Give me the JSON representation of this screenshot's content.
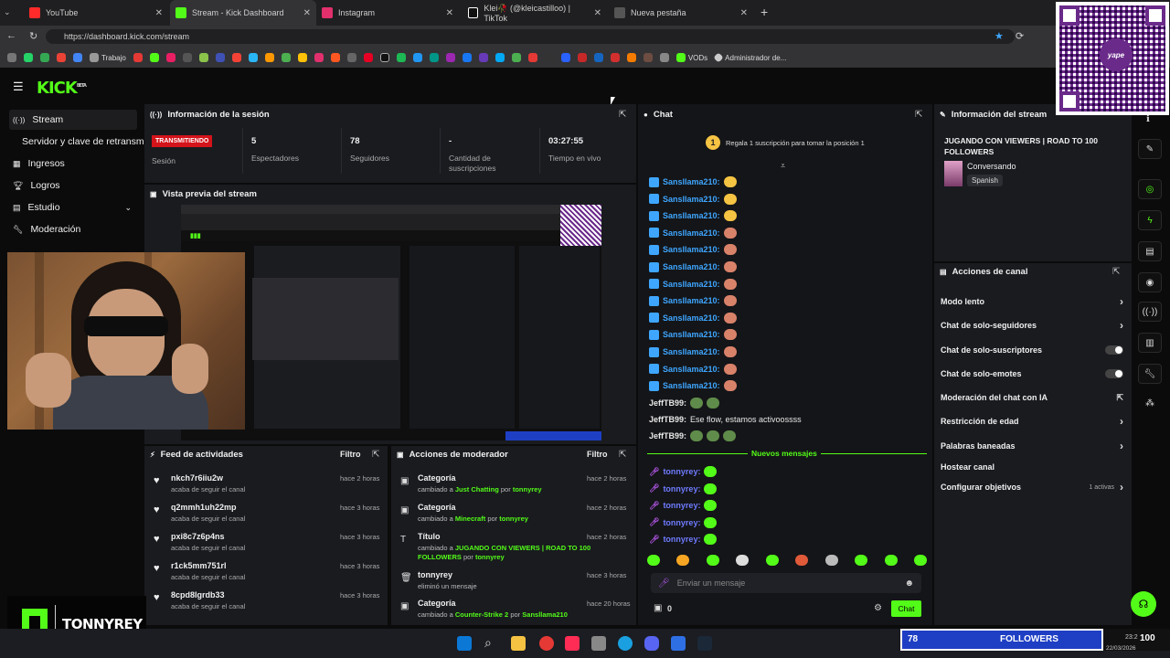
{
  "browser": {
    "tabs": [
      {
        "label": "YouTube",
        "color": "#ff2b2b"
      },
      {
        "label": "Stream - Kick Dashboard",
        "color": "#53fc18"
      },
      {
        "label": "Instagram",
        "color": "#e1306c"
      },
      {
        "label": "Klei🥀 (@kleicastilloo) | TikTok",
        "color": "#ffffff"
      },
      {
        "label": "Nueva pestaña",
        "color": "#cccccc"
      }
    ],
    "new_tab": "+",
    "url": "https://dashboard.kick.com/stream",
    "bookmarks": {
      "trabajo": "Trabajo",
      "vods": "VODs",
      "admin": "Administrador de..."
    }
  },
  "app": {
    "logo": "KICK",
    "logo_sup": "BETA"
  },
  "sidebar": {
    "items": [
      {
        "label": "Stream",
        "icon": "signal-icon"
      },
      {
        "label": "Servidor y clave de retransmisión",
        "icon": ""
      },
      {
        "label": "Ingresos",
        "icon": "grid-icon"
      },
      {
        "label": "Logros",
        "icon": "trophy-icon"
      },
      {
        "label": "Estudio",
        "icon": "book-icon"
      },
      {
        "label": "Moderación",
        "icon": "wrench-icon"
      }
    ]
  },
  "session": {
    "title": "Información de la sesión",
    "badge": "TRANSMITIENDO",
    "badge_label": "Sesión",
    "stats": [
      {
        "value": "5",
        "label": "Espectadores"
      },
      {
        "value": "78",
        "label": "Seguidores"
      },
      {
        "value": "-",
        "label": "Cantidad de suscripciones"
      },
      {
        "value": "03:27:55",
        "label": "Tiempo en vivo"
      }
    ]
  },
  "preview": {
    "title": "Vista previa del stream"
  },
  "feed": {
    "title": "Feed de actividades",
    "filter": "Filtro",
    "rows": [
      {
        "name": "nkch7r6iiu2w",
        "sub": "acaba de seguir el canal",
        "time": "hace 2 horas"
      },
      {
        "name": "q2mmh1uh22mp",
        "sub": "acaba de seguir el canal",
        "time": "hace 3 horas"
      },
      {
        "name": "pxi8c7z6p4ns",
        "sub": "acaba de seguir el canal",
        "time": "hace 3 horas"
      },
      {
        "name": "r1ck5mm751rl",
        "sub": "acaba de seguir el canal",
        "time": "hace 3 horas"
      },
      {
        "name": "8cpd8lgrdb33",
        "sub": "acaba de seguir el canal",
        "time": "hace 3 horas"
      }
    ]
  },
  "modactions": {
    "title": "Acciones de moderador",
    "filter": "Filtro",
    "rows": [
      {
        "title": "Categoría",
        "pre": "cambiado a",
        "value": "Just Chatting",
        "by": "por",
        "user": "tonnyrey",
        "time": "hace 2 horas"
      },
      {
        "title": "Categoría",
        "pre": "cambiado a",
        "value": "Minecraft",
        "by": "por",
        "user": "tonnyrey",
        "time": "hace 2 horas"
      },
      {
        "title": "Título",
        "pre": "cambiado a",
        "value": "JUGANDO CON VIEWERS | ROAD TO 100 FOLLOWERS",
        "by": "por",
        "user": "tonnyrey",
        "time": "hace 2 horas"
      },
      {
        "title": "tonnyrey",
        "pre": "eliminó un mensaje",
        "value": "",
        "by": "",
        "user": "",
        "time": "hace 3 horas"
      },
      {
        "title": "Categoría",
        "pre": "cambiado a",
        "value": "Counter-Strike 2",
        "by": "por",
        "user": "Sansllama210",
        "time": "hace 20 horas"
      }
    ]
  },
  "chat": {
    "title": "Chat",
    "gift_rank": "1",
    "gift_text": "Regala 1 suscripción para tomar la posición 1",
    "spam_user": "Sansllama210:",
    "jeff_user": "JeffTB99:",
    "jeff_msg": "Ese flow, estamos activoossss",
    "new_messages": "Nuevos mensajes",
    "tonny_user": "tonnyrey:",
    "input_placeholder": "Enviar un mensaje",
    "points": "0",
    "send": "Chat"
  },
  "streaminfo": {
    "title": "Información del stream",
    "stream_title": "JUGANDO CON VIEWERS | ROAD TO 100 FOLLOWERS",
    "category": "Conversando",
    "language": "Spanish"
  },
  "channel": {
    "title": "Acciones de canal",
    "rows": [
      {
        "label": "Modo lento",
        "kind": "chev"
      },
      {
        "label": "Chat de solo-seguidores",
        "kind": "chev"
      },
      {
        "label": "Chat de solo-suscriptores",
        "kind": "toggle"
      },
      {
        "label": "Chat de solo-emotes",
        "kind": "toggle"
      },
      {
        "label": "Moderación del chat con IA",
        "kind": "ext"
      },
      {
        "label": "Restricción de edad",
        "kind": "chev"
      },
      {
        "label": "Palabras baneadas",
        "kind": "chev"
      },
      {
        "label": "Hostear canal",
        "kind": "none"
      },
      {
        "label": "Configurar objetivos",
        "kind": "chev"
      }
    ],
    "goals_active": "1 activas"
  },
  "overlay": {
    "streamer_name": "TONNYREY",
    "followers_count": "78",
    "followers_label": "FOLLOWERS",
    "goal": "100",
    "qr_label": "yape"
  },
  "taskbar": {
    "time": "23:2",
    "date": "22/03/2026"
  },
  "colors": {
    "kick_green": "#53fc18",
    "live_red": "#d4131a",
    "follower_blue": "#1e3fc4",
    "chat_blue": "#3ea6ff"
  }
}
